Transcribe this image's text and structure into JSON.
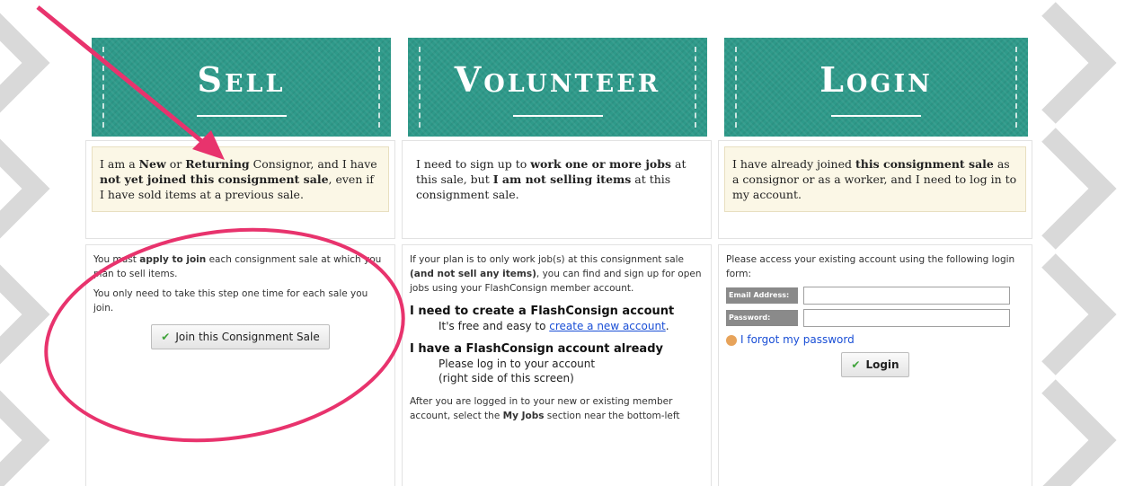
{
  "sell": {
    "title": "Sell",
    "description_parts": [
      "I am a ",
      "New",
      " or ",
      "Returning",
      " Consignor, and I have ",
      "not yet joined this consignment sale",
      ", even if I have sold items at a previous sale."
    ],
    "detail_1_parts": [
      "You must ",
      "apply to join",
      " each consignment sale at which you plan to sell items."
    ],
    "detail_2": "You only need to take this step one time for each sale you join.",
    "button_label": "Join this Consignment Sale"
  },
  "volunteer": {
    "title": "Volunteer",
    "description_parts": [
      "I need to sign up to ",
      "work one or more jobs",
      " at this sale, but ",
      "I am not selling items",
      " at this consignment sale."
    ],
    "detail_1_parts": [
      "If your plan is to only work job(s) at this consignment sale ",
      "(and not sell any items)",
      ", you can find and sign up for open jobs using your FlashConsign member account."
    ],
    "heading_1": "I need to create a FlashConsign account",
    "heading_1_text": "It's free and easy to ",
    "create_link": "create a new account",
    "heading_1_end": ".",
    "heading_2": "I have a FlashConsign account already",
    "heading_2_line1": "Please log in to your account",
    "heading_2_line2": "(right side of this screen)",
    "detail_2_parts": [
      "After you are logged in to your new or existing member account, select the ",
      "My Jobs",
      " section near the bottom-left"
    ]
  },
  "login": {
    "title": "Login",
    "description_parts": [
      "I have already joined ",
      "this consignment sale",
      " as a consignor or as a worker, and I need to log in to my account."
    ],
    "form_intro": "Please access your existing account using the following login form:",
    "email_label": "Email Address:",
    "password_label": "Password:",
    "forgot_label": "I forgot my password",
    "button_label": "Login"
  },
  "colors": {
    "banner": "#2e9a8a",
    "note_bg": "#fbf7e6",
    "annotation": "#e8336d",
    "link": "#1a4fd6"
  }
}
